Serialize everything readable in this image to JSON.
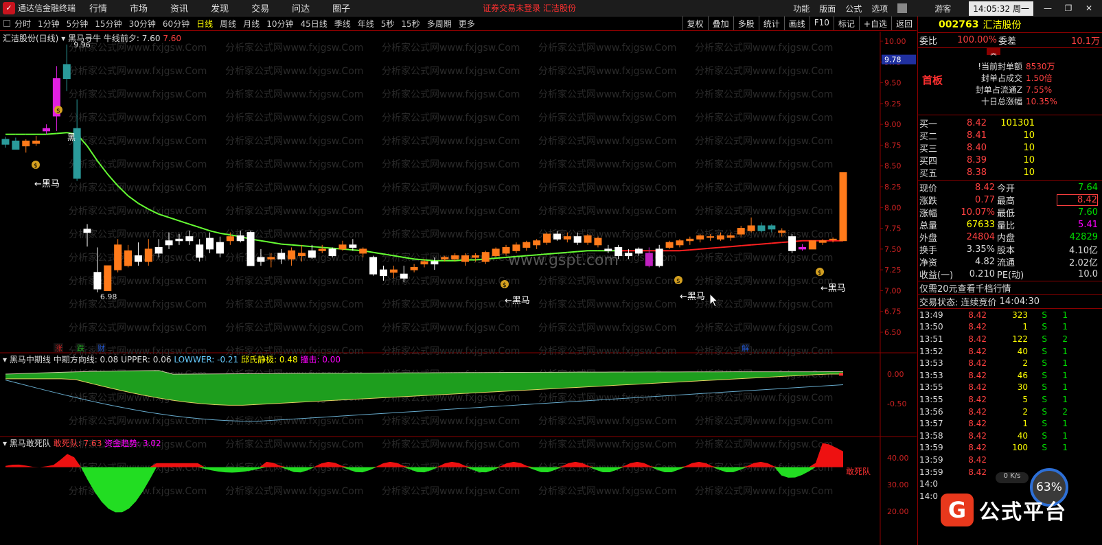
{
  "topbar": {
    "app_name": "通达信金融终端",
    "menus": [
      "行情",
      "市场",
      "资讯",
      "发现",
      "交易",
      "问达",
      "圈子"
    ],
    "login_notice": "证券交易未登录  汇洁股份",
    "right_menus": [
      "功能",
      "版面",
      "公式",
      "选项"
    ],
    "guest": "游客",
    "clock": "14:05:32 周一"
  },
  "tabs": {
    "periods": [
      "分时",
      "1分钟",
      "5分钟",
      "15分钟",
      "30分钟",
      "60分钟",
      "日线",
      "周线",
      "月线",
      "10分钟",
      "45日线",
      "季线",
      "年线",
      "5秒",
      "15秒",
      "多周期",
      "更多"
    ],
    "active": "日线",
    "tools": [
      "复权",
      "叠加",
      "多股",
      "统计",
      "画线",
      "F10",
      "标记",
      "+自选",
      "返回"
    ]
  },
  "main_chart": {
    "stock_label": "汇洁股份(日线)",
    "indicator_name": "黑马寻牛",
    "line_label": "牛线前夕: 7.60",
    "line_value": "7.60",
    "high_marker": "9.96",
    "low_marker": "6.98",
    "price_tag": "9.78",
    "y_ticks": [
      "10.00",
      "9.75",
      "9.50",
      "9.25",
      "9.00",
      "8.75",
      "8.50",
      "8.25",
      "8.00",
      "7.75",
      "7.50",
      "7.25",
      "7.00",
      "6.75",
      "6.50"
    ],
    "annotations": [
      "←黑马",
      "←黑马",
      "←黑马",
      "←黑马"
    ],
    "event_tags": [
      "涨",
      "跌",
      "财",
      "解"
    ],
    "watermark": "分析家公式网www.fxjgsw.Com",
    "site_watermark": "www.gspt.com",
    "candles": [
      [
        8.82,
        8.85,
        8.72,
        8.76
      ],
      [
        8.8,
        8.84,
        8.72,
        8.7
      ],
      [
        8.74,
        8.82,
        8.66,
        8.8
      ],
      [
        8.77,
        8.86,
        8.74,
        8.8
      ],
      [
        8.95,
        9.0,
        8.88,
        8.92
      ],
      [
        9.1,
        9.7,
        8.92,
        9.55
      ],
      [
        9.72,
        9.96,
        9.4,
        9.55
      ],
      [
        8.95,
        9.3,
        8.32,
        8.35
      ],
      [
        7.74,
        7.8,
        7.53,
        7.7
      ],
      [
        7.22,
        7.52,
        6.98,
        7.02
      ],
      [
        7.0,
        7.3,
        7.0,
        7.3
      ],
      [
        7.25,
        7.62,
        7.22,
        7.55
      ],
      [
        7.3,
        7.55,
        7.28,
        7.48
      ],
      [
        7.42,
        7.58,
        7.3,
        7.35
      ],
      [
        7.35,
        7.62,
        7.3,
        7.5
      ],
      [
        7.52,
        7.62,
        7.4,
        7.45
      ],
      [
        7.6,
        7.7,
        7.5,
        7.55
      ],
      [
        7.62,
        7.68,
        7.55,
        7.6
      ],
      [
        7.65,
        7.72,
        7.55,
        7.6
      ],
      [
        7.55,
        7.62,
        7.35,
        7.4
      ],
      [
        7.63,
        7.7,
        7.45,
        7.5
      ],
      [
        7.58,
        7.65,
        7.4,
        7.45
      ],
      [
        7.6,
        7.7,
        7.55,
        7.65
      ],
      [
        7.66,
        7.72,
        7.58,
        7.6
      ],
      [
        7.7,
        7.72,
        7.35,
        7.3
      ],
      [
        7.4,
        7.5,
        7.3,
        7.35
      ],
      [
        7.38,
        7.45,
        7.28,
        7.4
      ],
      [
        7.45,
        7.5,
        7.32,
        7.38
      ],
      [
        7.38,
        7.52,
        7.3,
        7.48
      ],
      [
        7.42,
        7.55,
        7.35,
        7.45
      ],
      [
        7.48,
        7.55,
        7.38,
        7.4
      ],
      [
        7.48,
        7.55,
        7.45,
        7.5
      ],
      [
        7.5,
        7.52,
        7.4,
        7.42
      ],
      [
        7.5,
        7.6,
        7.48,
        7.55
      ],
      [
        7.55,
        7.62,
        7.48,
        7.52
      ],
      [
        7.45,
        7.52,
        7.4,
        7.5
      ],
      [
        7.4,
        7.42,
        7.18,
        7.2
      ],
      [
        7.25,
        7.3,
        7.12,
        7.18
      ],
      [
        7.22,
        7.3,
        7.15,
        7.25
      ],
      [
        7.2,
        7.3,
        7.1,
        7.15
      ],
      [
        7.25,
        7.32,
        7.22,
        7.28
      ],
      [
        7.32,
        7.38,
        7.28,
        7.35
      ],
      [
        7.35,
        7.4,
        7.25,
        7.32
      ],
      [
        7.38,
        7.42,
        7.35,
        7.4
      ],
      [
        7.38,
        7.45,
        7.35,
        7.42
      ],
      [
        7.35,
        7.45,
        7.3,
        7.42
      ],
      [
        7.4,
        7.45,
        7.35,
        7.42
      ],
      [
        7.35,
        7.48,
        7.32,
        7.46
      ],
      [
        7.42,
        7.52,
        7.4,
        7.5
      ],
      [
        7.45,
        7.55,
        7.42,
        7.52
      ],
      [
        7.48,
        7.58,
        7.45,
        7.55
      ],
      [
        7.52,
        7.6,
        7.48,
        7.58
      ],
      [
        7.55,
        7.62,
        7.5,
        7.6
      ],
      [
        7.58,
        7.7,
        7.55,
        7.68
      ],
      [
        7.68,
        7.72,
        7.6,
        7.62
      ],
      [
        7.62,
        7.7,
        7.58,
        7.65
      ],
      [
        7.65,
        7.7,
        7.55,
        7.58
      ],
      [
        7.58,
        7.68,
        7.55,
        7.66
      ],
      [
        7.55,
        7.65,
        7.52,
        7.63
      ],
      [
        7.5,
        7.55,
        7.45,
        7.48
      ],
      [
        7.52,
        7.55,
        7.38,
        7.42
      ],
      [
        7.45,
        7.5,
        7.38,
        7.42
      ],
      [
        7.5,
        7.52,
        7.42,
        7.45
      ],
      [
        7.45,
        7.52,
        7.28,
        7.3
      ],
      [
        7.5,
        7.55,
        7.28,
        7.3
      ],
      [
        7.52,
        7.6,
        7.5,
        7.58
      ],
      [
        7.55,
        7.62,
        7.52,
        7.6
      ],
      [
        7.6,
        7.65,
        7.55,
        7.62
      ],
      [
        7.62,
        7.68,
        7.58,
        7.66
      ],
      [
        7.64,
        7.68,
        7.6,
        7.65
      ],
      [
        7.62,
        7.7,
        7.6,
        7.66
      ],
      [
        7.64,
        7.7,
        7.6,
        7.66
      ],
      [
        7.68,
        7.78,
        7.65,
        7.75
      ],
      [
        7.72,
        7.88,
        7.7,
        7.78
      ],
      [
        7.78,
        7.82,
        7.7,
        7.72
      ],
      [
        7.74,
        7.8,
        7.7,
        7.78
      ],
      [
        7.7,
        7.75,
        7.65,
        7.72
      ],
      [
        7.65,
        7.68,
        7.45,
        7.48
      ],
      [
        7.52,
        7.56,
        7.48,
        7.5
      ],
      [
        7.5,
        7.6,
        7.5,
        7.6
      ],
      [
        7.58,
        7.62,
        7.55,
        7.6
      ],
      [
        7.62,
        7.64,
        7.58,
        7.62
      ],
      [
        7.6,
        8.42,
        7.6,
        8.42
      ]
    ],
    "bull_line": [
      8.88,
      8.88,
      8.88,
      8.88,
      8.88,
      8.89,
      8.9,
      8.88,
      8.74,
      8.56,
      8.4,
      8.26,
      8.14,
      8.05,
      7.98,
      7.92,
      7.88,
      7.84,
      7.8,
      7.76,
      7.72,
      7.69,
      7.67,
      7.65,
      7.62,
      7.6,
      7.58,
      7.56,
      7.55,
      7.54,
      7.53,
      7.52,
      7.51,
      7.5,
      7.49,
      7.48,
      7.46,
      7.44,
      7.42,
      7.4,
      7.38,
      7.37,
      7.36,
      7.36,
      7.36,
      7.37,
      7.37,
      7.38,
      7.39,
      7.4,
      7.41,
      7.42,
      7.43,
      7.44,
      7.45,
      7.46,
      7.47,
      7.48,
      7.48,
      7.48,
      7.48,
      7.48,
      7.48,
      7.48,
      7.48,
      7.48,
      7.48,
      7.49,
      7.5,
      7.51,
      7.52,
      7.53,
      7.54,
      7.55,
      7.56,
      7.57,
      7.58,
      7.59,
      7.6,
      7.6,
      7.6,
      7.6,
      7.6
    ]
  },
  "mid_panel": {
    "name": "黑马中期线",
    "dir_label": "中期方向线: 0.08",
    "upper_label": "UPPER: 0.06",
    "lower_label": "LOWWER: -0.21",
    "qiu_label": "邱氏静极: 0.48",
    "hit_label": "撞击: 0.00",
    "y_ticks": [
      "0.00",
      "-0.50"
    ]
  },
  "bottom_panel": {
    "name": "黑马敢死队",
    "team_label": "敢死队: 7.63",
    "fund_label": "资金趋势: 3.02",
    "y_ticks": [
      "40.00",
      "30.00",
      "20.00"
    ],
    "end_label": "敢死队"
  },
  "quote": {
    "code": "002763",
    "name": "汇洁股份",
    "wei_bi_label": "委比",
    "wei_bi": "100.00%",
    "wei_cha_label": "委差",
    "wei_cha": "10.1万",
    "first_board": "首板",
    "board_stats": [
      {
        "label": "!当前封单额",
        "value": "8530万"
      },
      {
        "label": "封单占成交",
        "value": "1.50倍"
      },
      {
        "label": "封单占流通Z",
        "value": "7.55%"
      },
      {
        "label": "十日总涨幅",
        "value": "10.35%"
      }
    ],
    "bids": [
      {
        "label": "买一",
        "price": "8.42",
        "vol": "101301"
      },
      {
        "label": "买二",
        "price": "8.41",
        "vol": "10"
      },
      {
        "label": "买三",
        "price": "8.40",
        "vol": "10"
      },
      {
        "label": "买四",
        "price": "8.39",
        "vol": "10"
      },
      {
        "label": "买五",
        "price": "8.38",
        "vol": "10"
      }
    ],
    "stats": [
      [
        "现价",
        "8.42",
        "今开",
        "7.64"
      ],
      [
        "涨跌",
        "0.77",
        "最高",
        "8.42"
      ],
      [
        "涨幅",
        "10.07%",
        "最低",
        "7.60"
      ],
      [
        "总量",
        "67633",
        "量比",
        "5.41"
      ],
      [
        "外盘",
        "24804",
        "内盘",
        "42829"
      ],
      [
        "换手",
        "3.35%",
        "股本",
        "4.10亿"
      ],
      [
        "净资",
        "4.82",
        "流通",
        "2.02亿"
      ],
      [
        "收益(一)",
        "0.210",
        "PE(动)",
        "10.0"
      ]
    ],
    "promo": "仅需20元查看千档行情",
    "trade_status_label": "交易状态: 连续竞价",
    "trade_status_time": "14:04:30",
    "ticks": [
      [
        "13:49",
        "8.42",
        "323",
        "S",
        "1"
      ],
      [
        "13:50",
        "8.42",
        "1",
        "S",
        "1"
      ],
      [
        "13:51",
        "8.42",
        "122",
        "S",
        "2"
      ],
      [
        "13:52",
        "8.42",
        "40",
        "S",
        "1"
      ],
      [
        "13:53",
        "8.42",
        "2",
        "S",
        "1"
      ],
      [
        "13:53",
        "8.42",
        "46",
        "S",
        "1"
      ],
      [
        "13:55",
        "8.42",
        "30",
        "S",
        "1"
      ],
      [
        "13:55",
        "8.42",
        "5",
        "S",
        "1"
      ],
      [
        "13:56",
        "8.42",
        "2",
        "S",
        "2"
      ],
      [
        "13:57",
        "8.42",
        "1",
        "S",
        "1"
      ],
      [
        "13:58",
        "8.42",
        "40",
        "S",
        "1"
      ],
      [
        "13:59",
        "8.42",
        "100",
        "S",
        "1"
      ],
      [
        "13:59",
        "8.42",
        "",
        "",
        ""
      ],
      [
        "13:59",
        "8.42",
        "",
        "",
        ""
      ],
      [
        "14:0",
        "",
        "",
        "",
        ""
      ],
      [
        "14:0",
        "",
        "",
        "",
        ""
      ]
    ],
    "net_speed": "0 K/s",
    "cpu": "63%",
    "brand": "公式平台"
  }
}
